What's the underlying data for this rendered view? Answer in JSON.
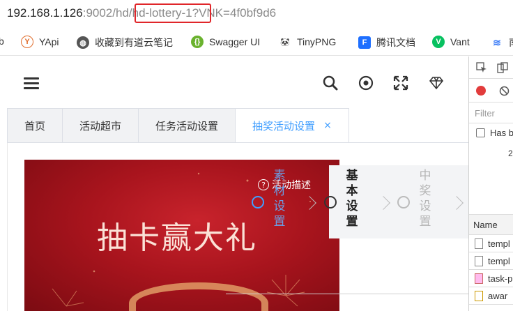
{
  "browser": {
    "url_host": "192.168.1.126",
    "url_port_path": ":9002/hd/",
    "url_highlight": "hd-lottery-1",
    "url_rest": "?VNK=4f0bf9d6"
  },
  "bookmarks": [
    {
      "label": "b",
      "icon": "bookmark-fragment",
      "color": "#555"
    },
    {
      "label": "YApi",
      "icon": "yapi-icon",
      "color": "#e06c2b"
    },
    {
      "label": "收藏到有道云笔记",
      "icon": "globe-icon",
      "color": "#555"
    },
    {
      "label": "Swagger UI",
      "icon": "swagger-icon",
      "color": "#6ab22e"
    },
    {
      "label": "TinyPNG",
      "icon": "panda-icon",
      "color": "#333"
    },
    {
      "label": "腾讯文档",
      "icon": "tencent-docs-icon",
      "color": "#1e6fff"
    },
    {
      "label": "Vant",
      "icon": "vant-icon",
      "color": "#07c160"
    },
    {
      "label": "南",
      "icon": "layers-icon",
      "color": "#3a7bf7"
    }
  ],
  "header": {
    "icons": [
      "search-icon",
      "target-icon",
      "fullscreen-icon",
      "diamond-icon"
    ]
  },
  "tabs": [
    {
      "label": "首页",
      "active": false
    },
    {
      "label": "活动超市",
      "active": false
    },
    {
      "label": "任务活动设置",
      "active": false
    },
    {
      "label": "抽奖活动设置",
      "active": true,
      "close": "×"
    }
  ],
  "banner": {
    "title": "抽卡赢大礼",
    "desc_label": "活动描述",
    "help_glyph": "?"
  },
  "steps": [
    {
      "label": "素材设置",
      "state": "active"
    },
    {
      "label": "基本设置",
      "state": "current"
    },
    {
      "label": "中奖设置",
      "state": "pending"
    }
  ],
  "devtools": {
    "filter_placeholder": "Filter",
    "has_label": "Has b",
    "number": "2",
    "column_name": "Name",
    "files": [
      "templ",
      "templ",
      "task-p",
      "awar"
    ]
  },
  "colors": {
    "accent": "#409eff",
    "banner_red": "#a8141d",
    "url_highlight": "#e0262a"
  }
}
